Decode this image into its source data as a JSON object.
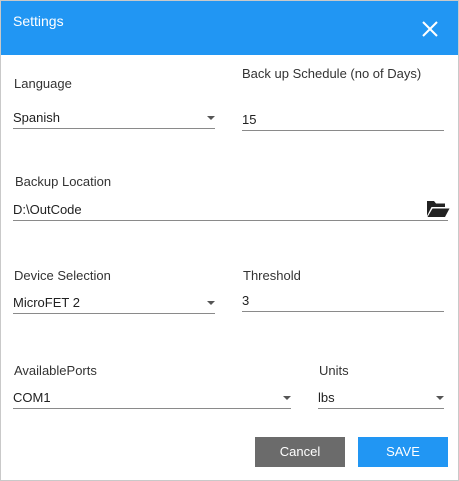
{
  "header": {
    "title": "Settings",
    "close_icon": "close-icon",
    "color": "#2196f3"
  },
  "language": {
    "label": "Language",
    "value": "Spanish"
  },
  "backup_schedule": {
    "label": "Back up Schedule (no of Days)",
    "value": "15"
  },
  "backup_location": {
    "label": "Backup Location",
    "value": "D:\\OutCode",
    "icon": "folder-open-icon"
  },
  "device_selection": {
    "label": "Device Selection",
    "value": "MicroFET 2"
  },
  "threshold": {
    "label": "Threshold",
    "value": "3"
  },
  "available_ports": {
    "label": "AvailablePorts",
    "value": "COM1"
  },
  "units": {
    "label": "Units",
    "value": "lbs"
  },
  "buttons": {
    "cancel_label": "Cancel",
    "cancel_color": "#6b6b6b",
    "save_label": "SAVE",
    "save_color": "#2196f3"
  }
}
